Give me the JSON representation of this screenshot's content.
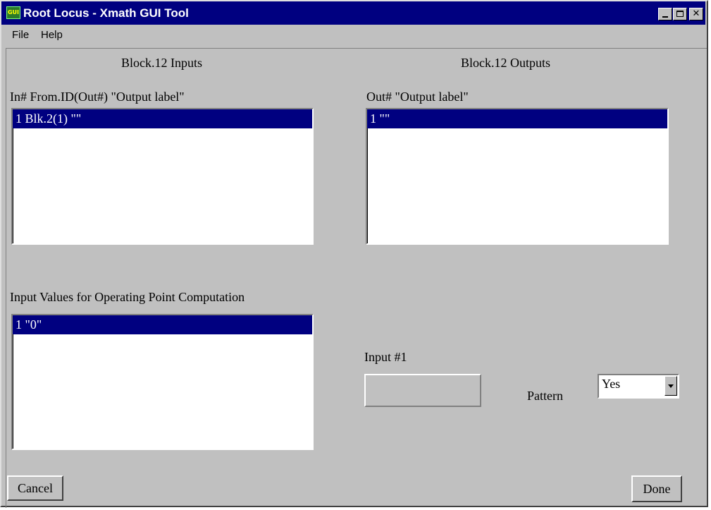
{
  "window": {
    "title": "Root Locus - Xmath GUI Tool",
    "icon": "gui-icon",
    "icon_text": "GUI",
    "titlebar_color": "#000080"
  },
  "menu": {
    "file": "File",
    "help": "Help"
  },
  "inputs_section": {
    "heading": "Block.12 Inputs",
    "column_header": "In# From.ID(Out#) \"Output label\"",
    "items": [
      {
        "text": "1 Blk.2(1) \"\"",
        "selected": true
      }
    ]
  },
  "outputs_section": {
    "heading": "Block.12 Outputs",
    "column_header": "Out# \"Output label\"",
    "items": [
      {
        "text": "1 \"\"",
        "selected": true
      }
    ]
  },
  "operating_point": {
    "heading": "Input Values for Operating Point Computation",
    "items": [
      {
        "text": "1 \"0\"",
        "selected": true
      }
    ]
  },
  "input_editor": {
    "label": "Input #1",
    "value": ""
  },
  "pattern": {
    "label": "Pattern",
    "value": "Yes"
  },
  "buttons": {
    "cancel": "Cancel",
    "done": "Done"
  }
}
